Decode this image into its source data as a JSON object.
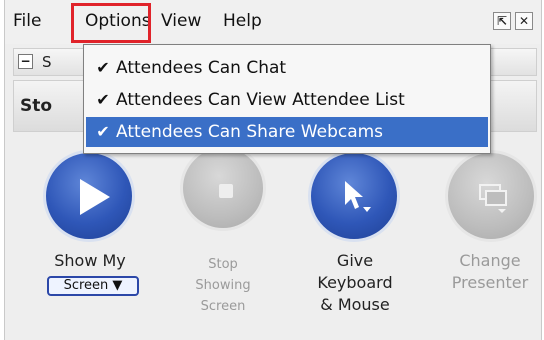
{
  "menubar": {
    "file": "File",
    "options": "Options",
    "view": "View",
    "help": "Help",
    "popout_glyph": "⇱",
    "close_glyph": "✕"
  },
  "panel": {
    "collapse_glyph": "−",
    "section_label_fragment": "S",
    "stop_label_fragment": "Sto"
  },
  "options_menu": {
    "items": [
      {
        "label": "Attendees Can Chat",
        "checked": "✔",
        "selected": false
      },
      {
        "label": "Attendees Can View Attendee List",
        "checked": "✔",
        "selected": false
      },
      {
        "label": "Attendees Can Share Webcams",
        "checked": "✔",
        "selected": true
      }
    ],
    "highlight_color": "#3a6fc7"
  },
  "controls": {
    "show_my": "Show My",
    "screen_dropdown": "Screen ▼",
    "stop_line1": "Stop",
    "stop_line2": "Showing",
    "stop_line3": "Screen",
    "give_line1": "Give",
    "give_line2": "Keyboard",
    "give_line3": "& Mouse",
    "change_line1": "Change",
    "change_line2": "Presenter"
  },
  "icons": {
    "show_screen": "play-icon",
    "stop_showing": "stop-icon",
    "give_control": "cursor-icon",
    "change_presenter": "presenter-icon"
  },
  "colors": {
    "annotation_box": "#e0232a",
    "active_button": "#2f57b8",
    "disabled_button": "#bdbdbd"
  }
}
